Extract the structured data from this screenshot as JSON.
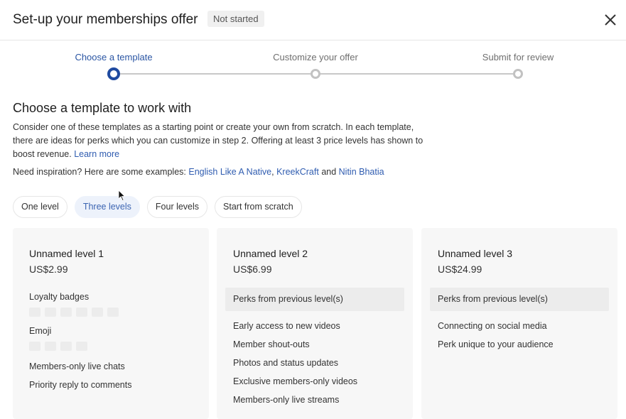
{
  "header": {
    "title": "Set-up your memberships offer",
    "status_badge": "Not started",
    "close_icon": "close-icon"
  },
  "stepper": {
    "steps": [
      {
        "label": "Choose a template",
        "state": "active"
      },
      {
        "label": "Customize your offer",
        "state": "pending"
      },
      {
        "label": "Submit for review",
        "state": "pending"
      }
    ]
  },
  "main": {
    "section_title": "Choose a template to work with",
    "description": "Consider one of these templates as a starting point or create your own from scratch. In each template, there are ideas for perks which you can customize in step 2. Offering at least 3 price levels has shown to boost revenue.",
    "learn_more": "Learn more",
    "inspiration_prefix": "Need inspiration? Here are some examples:",
    "examples": [
      "English Like A Native",
      "KreekCraft",
      "Nitin Bhatia"
    ],
    "comma": ",",
    "and": "and"
  },
  "templates": {
    "chips": [
      {
        "label": "One level",
        "selected": false
      },
      {
        "label": "Three levels",
        "selected": true
      },
      {
        "label": "Four levels",
        "selected": false
      },
      {
        "label": "Start from scratch",
        "selected": false
      }
    ]
  },
  "levels": [
    {
      "name": "Unnamed level 1",
      "price": "US$2.99",
      "badges_label": "Loyalty badges",
      "badge_count": 6,
      "emoji_label": "Emoji",
      "emoji_count": 4,
      "perks": [
        "Members-only live chats",
        "Priority reply to comments"
      ]
    },
    {
      "name": "Unnamed level 2",
      "price": "US$6.99",
      "previous_perks": "Perks from previous level(s)",
      "perks": [
        "Early access to new videos",
        "Member shout-outs",
        "Photos and status updates",
        "Exclusive members-only videos",
        "Members-only live streams"
      ]
    },
    {
      "name": "Unnamed level 3",
      "price": "US$24.99",
      "previous_perks": "Perks from previous level(s)",
      "perks": [
        "Connecting on social media",
        "Perk unique to your audience"
      ]
    }
  ],
  "colors": {
    "accent": "#1f4aa0",
    "link": "#2f5cb0",
    "chip_selected_bg": "#edf2fb"
  }
}
